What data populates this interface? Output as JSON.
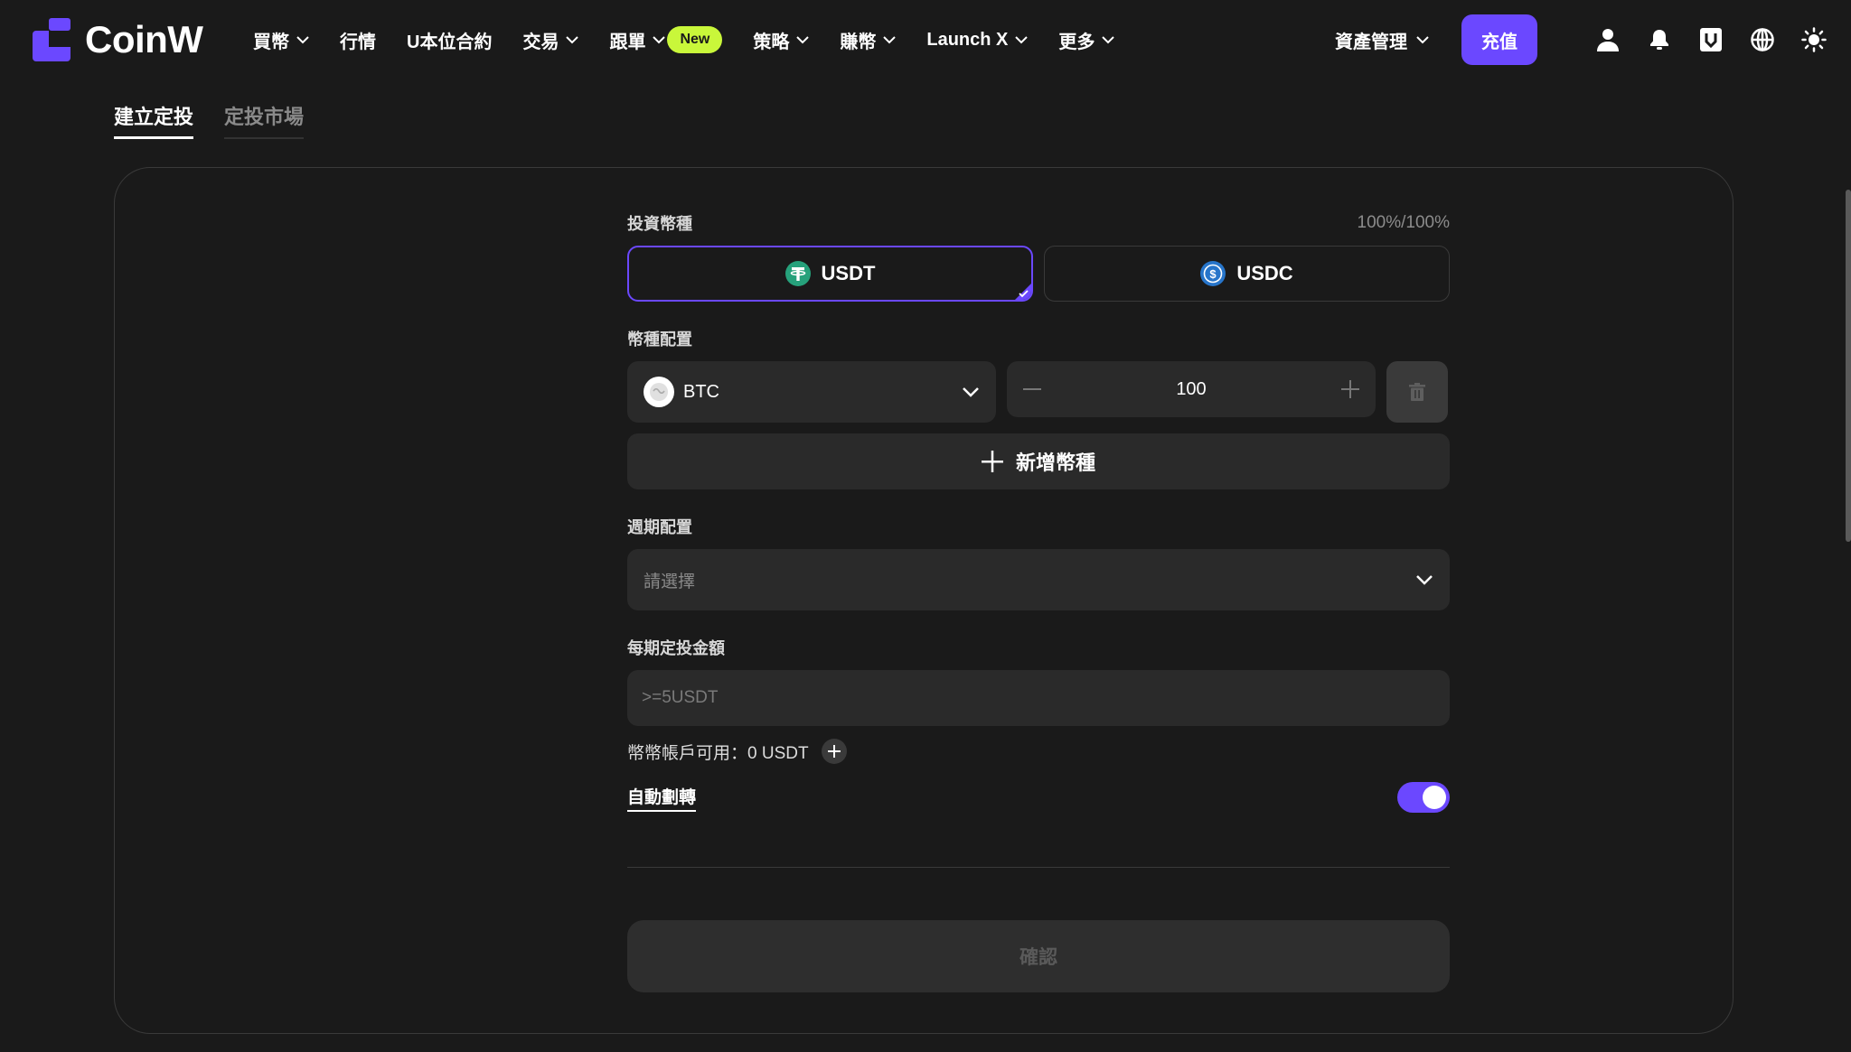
{
  "brand": {
    "name": "CoinW",
    "accent": "#6b48ff",
    "badge_color": "#c9f73a"
  },
  "nav": {
    "items": [
      {
        "label": "買幣",
        "has_dropdown": true
      },
      {
        "label": "行情",
        "has_dropdown": false
      },
      {
        "label": "U本位合約",
        "has_dropdown": false
      },
      {
        "label": "交易",
        "has_dropdown": true
      },
      {
        "label": "跟單",
        "has_dropdown": true,
        "badge": "New"
      },
      {
        "label": "策略",
        "has_dropdown": true
      },
      {
        "label": "賺幣",
        "has_dropdown": true
      },
      {
        "label": "Launch X",
        "has_dropdown": true
      },
      {
        "label": "更多",
        "has_dropdown": true
      }
    ]
  },
  "header_right": {
    "asset_management": "資產管理",
    "deposit": "充值",
    "icons": [
      "user-icon",
      "bell-icon",
      "download-icon",
      "globe-icon",
      "sun-icon"
    ]
  },
  "subtabs": [
    {
      "label": "建立定投",
      "active": true
    },
    {
      "label": "定投市場",
      "active": false
    }
  ],
  "form": {
    "invest_currency": {
      "label": "投資幣種",
      "ratio": "100%/100%",
      "options": [
        {
          "label": "USDT",
          "selected": true
        },
        {
          "label": "USDC",
          "selected": false
        }
      ]
    },
    "allocation": {
      "label": "幣種配置",
      "coin": "BTC",
      "amount": "100",
      "add_label": "新增幣種"
    },
    "period": {
      "label": "週期配置",
      "placeholder": "請選擇"
    },
    "amount": {
      "label": "每期定投金額",
      "placeholder": ">=5USDT",
      "available": "幣幣帳戶可用：0 USDT"
    },
    "auto_transfer": {
      "label": "自動劃轉",
      "enabled": true
    },
    "confirm_label": "確認"
  }
}
